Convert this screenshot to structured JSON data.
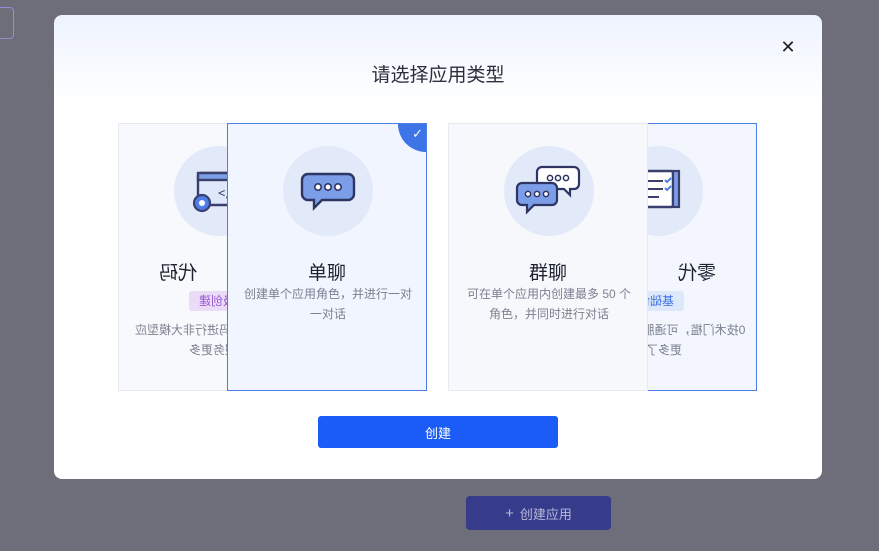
{
  "background": {
    "create_app_button": {
      "icon": "plus-icon",
      "label": "创建应用"
    }
  },
  "modal": {
    "title": "请选择应用类型",
    "close_icon": "close-icon",
    "create_label": "创建",
    "cards": [
      {
        "id": "code",
        "title": "代码",
        "badge": "级创建",
        "desc": "者，可通过代码进行非大模型应用服务更多",
        "icon": "code-gear-icon",
        "mirrored": true
      },
      {
        "id": "single-chat",
        "title": "单聊",
        "desc": "创建单个应用角色，并进行一对一对话",
        "icon": "single-chat-bubble-icon",
        "selected": true
      },
      {
        "id": "group-chat",
        "title": "群聊",
        "desc": "可在单个应用内创建最多 50 个角色，并同时进行对话",
        "icon": "group-chat-bubbles-icon"
      },
      {
        "id": "zero-code",
        "title": "零代",
        "badge": "基础创",
        "desc": "0技术门槛，可通服务，支持在线更多了解",
        "icon": "checklist-icon",
        "mirrored": true,
        "border_selected": true
      }
    ]
  },
  "colors": {
    "primary": "#1a5cf5",
    "selected_border": "#4b7ee8",
    "overlay": "#6d6e79"
  }
}
